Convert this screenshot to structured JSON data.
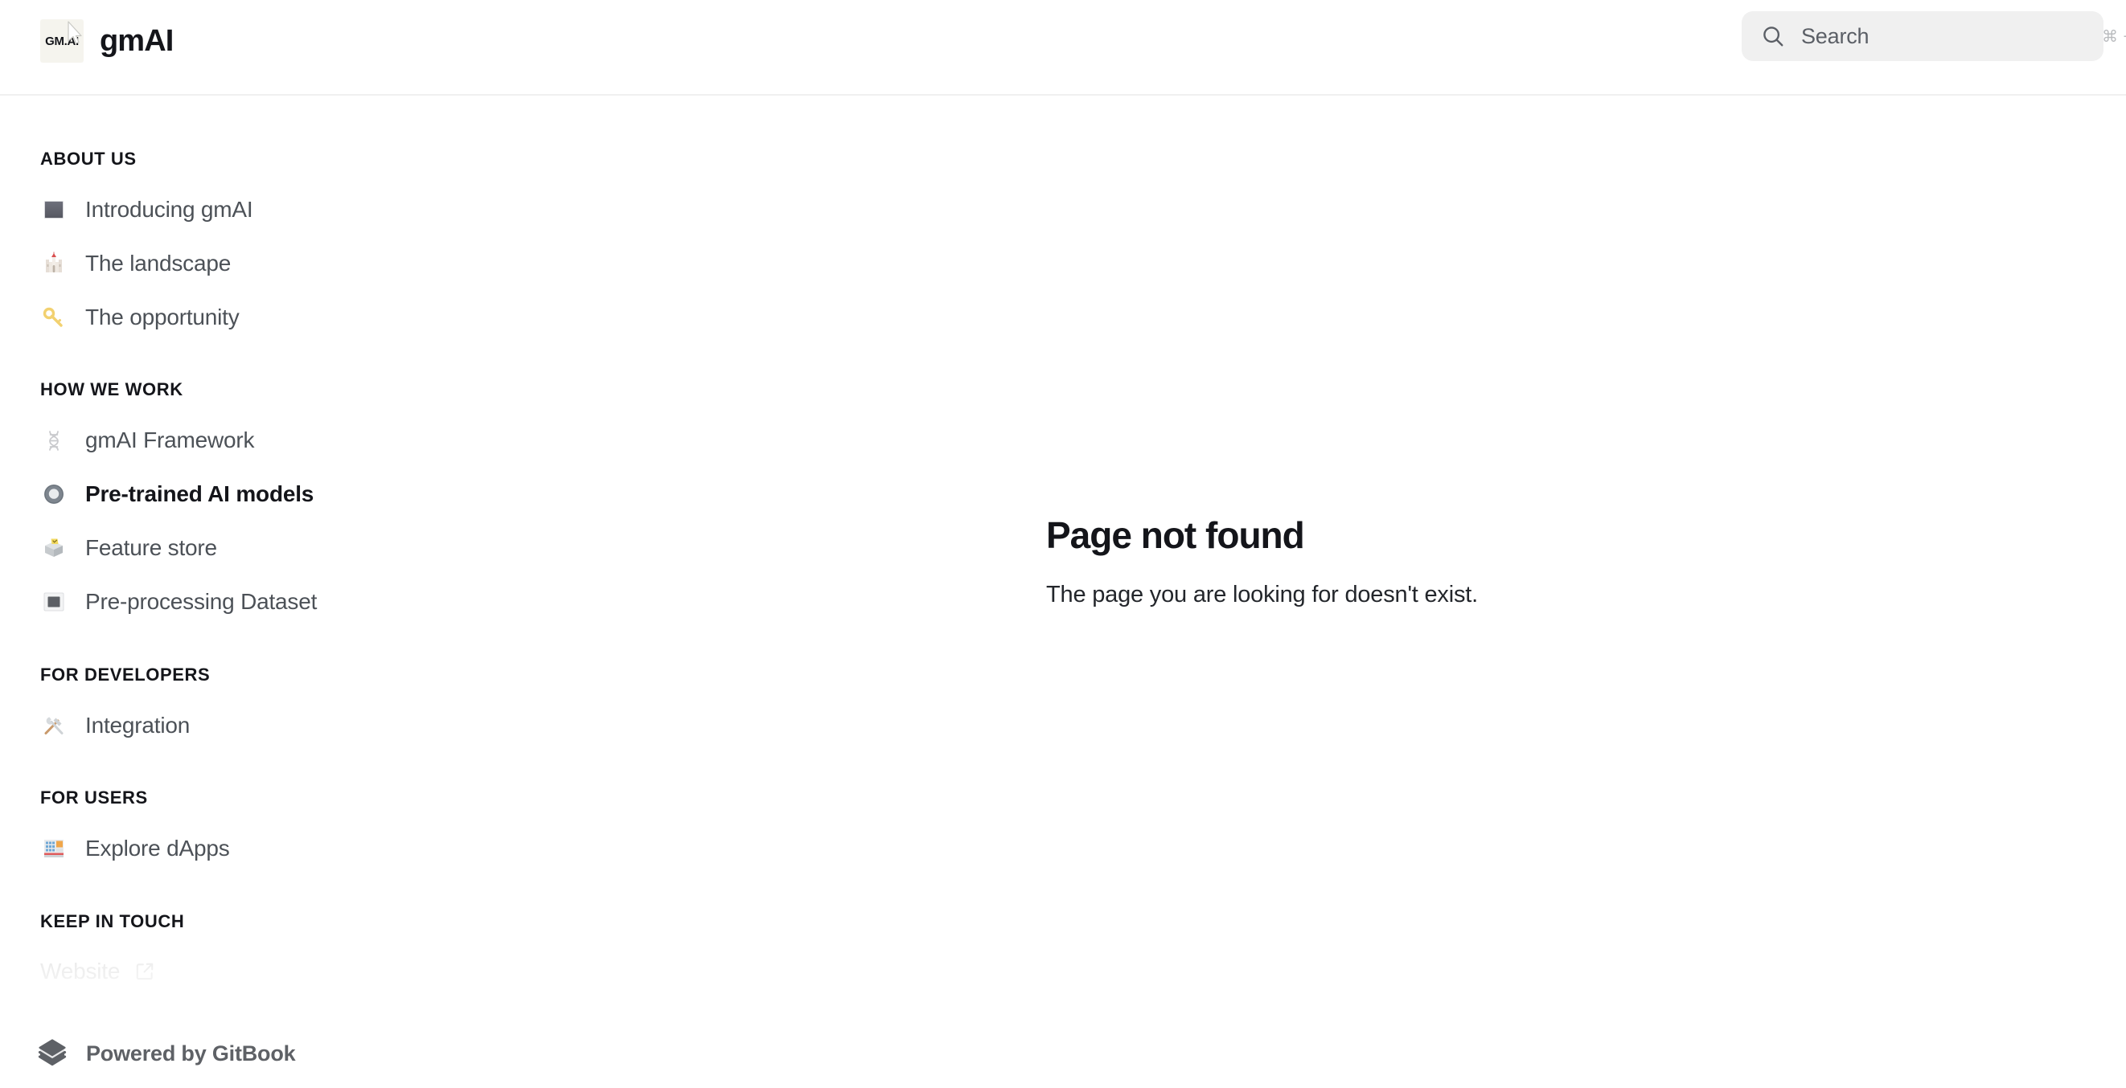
{
  "header": {
    "logo_text": "GM.AI",
    "title": "gmAI",
    "logo_bg": "#f5f4ee"
  },
  "search": {
    "placeholder": "Search",
    "value": "",
    "shortcut": "⌘ + K",
    "icon": "search-icon",
    "background": "#f0f0f0"
  },
  "sidebar": {
    "sections": [
      {
        "title": "ABOUT US",
        "items": [
          {
            "label": "Introducing gmAI",
            "icon": "dark-square-icon",
            "active": false
          },
          {
            "label": "The landscape",
            "icon": "castle-icon",
            "active": false
          },
          {
            "label": "The opportunity",
            "icon": "key-icon",
            "active": false
          }
        ]
      },
      {
        "title": "HOW WE WORK",
        "items": [
          {
            "label": "gmAI Framework",
            "icon": "dna-icon",
            "active": false
          },
          {
            "label": "Pre-trained AI models",
            "icon": "radio-button-icon",
            "active": true
          },
          {
            "label": "Feature store",
            "icon": "ballot-box-icon",
            "active": false
          },
          {
            "label": "Pre-processing Dataset",
            "icon": "black-square-button-icon",
            "active": false
          }
        ]
      },
      {
        "title": "FOR DEVELOPERS",
        "items": [
          {
            "label": "Integration",
            "icon": "hammer-and-wrench-icon",
            "active": false
          }
        ]
      },
      {
        "title": "FOR USERS",
        "items": [
          {
            "label": "Explore dApps",
            "icon": "department-store-icon",
            "active": false
          }
        ]
      }
    ],
    "keep_in_touch": {
      "title": "KEEP IN TOUCH",
      "links": [
        {
          "label": "Website",
          "icon": "external-link-icon"
        }
      ]
    }
  },
  "main": {
    "not_found_title": "Page not found",
    "not_found_text": "The page you are looking for doesn't exist."
  },
  "footer": {
    "powered_by_label": "Powered by GitBook",
    "icon": "gitbook-logo-icon"
  },
  "colors": {
    "text_primary": "#14151a",
    "text_muted": "#4c5157",
    "text_disabled": "#dedede",
    "border": "#f0f0f0",
    "background": "#ffffff"
  }
}
